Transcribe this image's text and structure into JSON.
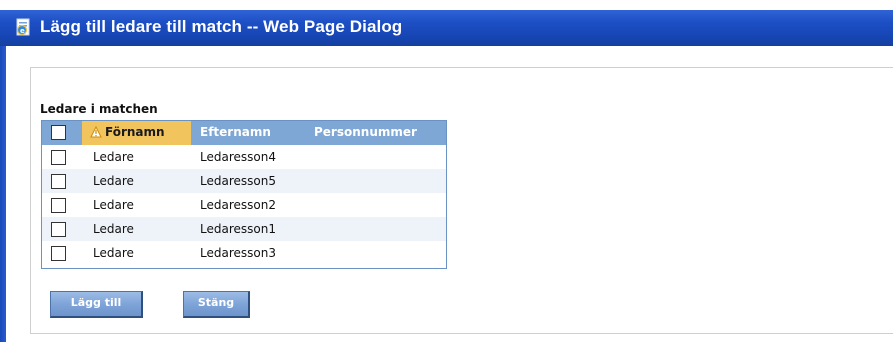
{
  "window": {
    "title": "Lägg till ledare till match -- Web Page Dialog",
    "icon": "ie-page-icon"
  },
  "section": {
    "title": "Ledare i matchen"
  },
  "grid": {
    "columns": [
      "Förnamn",
      "Efternamn",
      "Personnummer"
    ],
    "sorted_column": "Förnamn",
    "header_color": "#7ea7d6",
    "sorted_header_color": "#f2c45e",
    "rows": [
      {
        "fornamn": "Ledare",
        "efternamn": "Ledaresson4",
        "personnummer": ""
      },
      {
        "fornamn": "Ledare",
        "efternamn": "Ledaresson5",
        "personnummer": ""
      },
      {
        "fornamn": "Ledare",
        "efternamn": "Ledaresson2",
        "personnummer": ""
      },
      {
        "fornamn": "Ledare",
        "efternamn": "Ledaresson1",
        "personnummer": ""
      },
      {
        "fornamn": "Ledare",
        "efternamn": "Ledaresson3",
        "personnummer": ""
      }
    ]
  },
  "buttons": {
    "add_label": "Lägg till",
    "close_label": "Stäng"
  },
  "colors": {
    "titlebar": "#1d4fc4",
    "button": "#7ea4d8"
  }
}
